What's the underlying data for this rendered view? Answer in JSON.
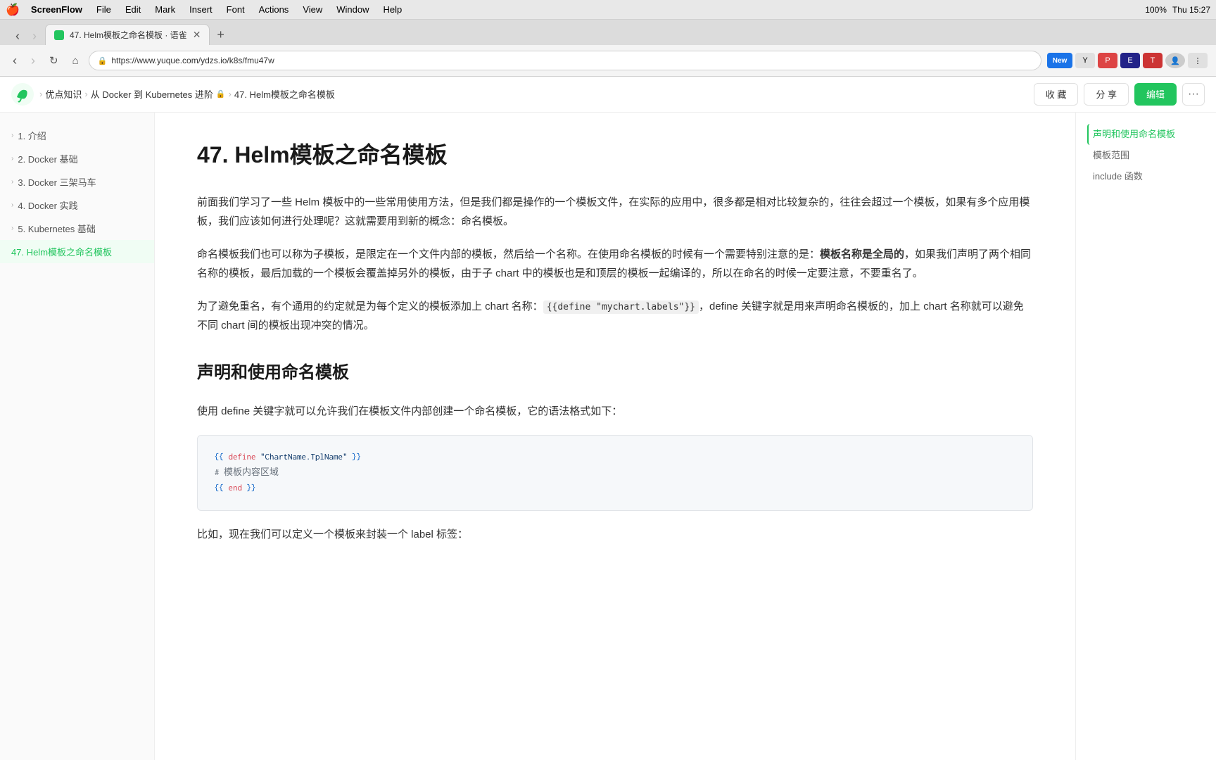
{
  "menubar": {
    "apple": "🍎",
    "items": [
      "ScreenFlow",
      "File",
      "Edit",
      "Mark",
      "Insert",
      "Font",
      "Actions",
      "View",
      "Window",
      "Help"
    ],
    "right": {
      "time": "Thu 15:27",
      "battery": "100%"
    }
  },
  "browser": {
    "tab": {
      "label": "47. Helm模板之命名模板 · 语雀",
      "url": "https://www.yuque.com/ydzs.io/k8s/fmu47w"
    },
    "new_tab_label": "+"
  },
  "page_topbar": {
    "breadcrumb": {
      "root": "优点知识",
      "parent": "从 Docker 到 Kubernetes 进阶",
      "current": "47. Helm模板之命名模板"
    },
    "actions": {
      "bookmark": "收 藏",
      "share": "分 享",
      "edit": "编辑"
    }
  },
  "sidebar": {
    "items": [
      {
        "label": "1. 介绍",
        "active": false
      },
      {
        "label": "2. Docker 基础",
        "active": false
      },
      {
        "label": "3. Docker 三架马车",
        "active": false
      },
      {
        "label": "4. Docker 实践",
        "active": false
      },
      {
        "label": "5. Kubernetes 基础",
        "active": false
      },
      {
        "label": "47. Helm模板之命名模板",
        "active": true
      }
    ]
  },
  "article": {
    "title": "47. Helm模板之命名模板",
    "paragraphs": [
      "前面我们学习了一些 Helm 模板中的一些常用使用方法，但是我们都是操作的一个模板文件，在实际的应用中，很多都是相对比较复杂的，往往会超过一个模板，如果有多个应用模板，我们应该如何进行处理呢？这就需要用到新的概念：命名模板。",
      "命名模板我们也可以称为子模板，是限定在一个文件内部的模板，然后给一个名称。在使用命名模板的时候有一个需要特别注意的是：模板名称是全局的，如果我们声明了两个相同名称的模板，最后加载的一个模板会覆盖掉另外的模板，由于子 chart 中的模板也是和顶层的模板一起编译的，所以在命名的时候一定要注意，不要重名了。",
      "为了避免重名，有个通用的约定就是为每个定义的模板添加上 chart 名称：{{define \"mychart.labels\"}}，define 关键字就是用来声明命名模板的，加上 chart 名称就可以避免不同 chart 间的模板出现冲突的情况。"
    ],
    "section1": {
      "title": "声明和使用命名模板",
      "text": "使用 define 关键字就可以允许我们在模板文件内部创建一个命名模板，它的语法格式如下：",
      "code": {
        "line1": "{{ define \"ChartName.TplName\" }}",
        "line2": "# 模板内容区域",
        "line3": "{{ end }}"
      }
    },
    "section2_intro": "比如，现在我们可以定义一个模板来封装一个 label 标签："
  },
  "toc": {
    "items": [
      {
        "label": "声明和使用命名模板",
        "active": true
      },
      {
        "label": "模板范围",
        "active": false
      },
      {
        "label": "include 函数",
        "active": false
      }
    ]
  }
}
